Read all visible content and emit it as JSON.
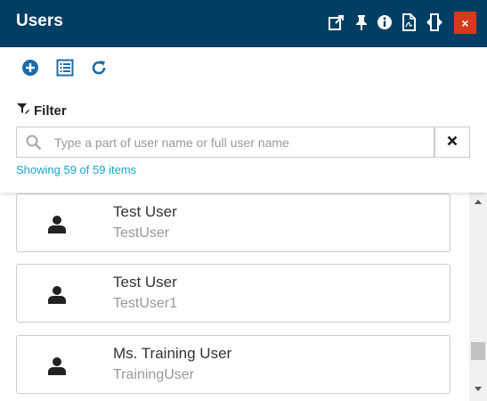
{
  "window": {
    "title": "Users",
    "close_label": "×",
    "header_icons": [
      "popout-icon",
      "pin-icon",
      "info-icon",
      "pdf-icon",
      "resize-icon"
    ]
  },
  "toolbar": {
    "icons": [
      "add-icon",
      "list-icon",
      "refresh-icon"
    ]
  },
  "filter": {
    "label": "Filter",
    "placeholder": "Type a part of user name or full user name",
    "value": "",
    "count_text": "Showing 59 of 59 items"
  },
  "users": [
    {
      "name": "Test User",
      "login": "TestUser"
    },
    {
      "name": "Test User",
      "login": "TestUser1"
    },
    {
      "name": "Ms. Training User",
      "login": "TrainingUser"
    }
  ],
  "colors": {
    "header_bg": "#003f63",
    "close_bg": "#d63a1a",
    "toolbar_icon": "#1c6ca8",
    "count_text": "#1aa5c8"
  }
}
